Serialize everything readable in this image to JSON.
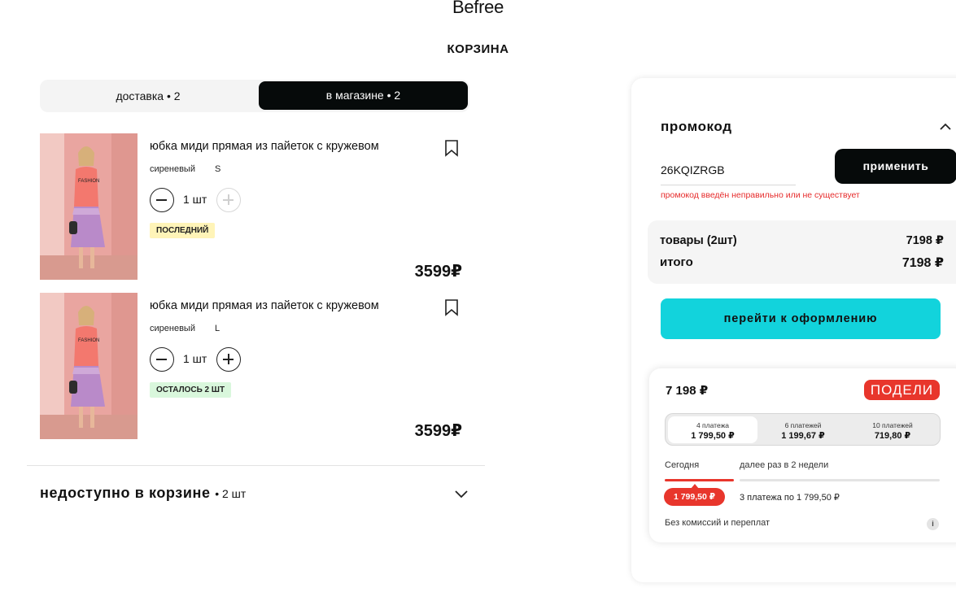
{
  "header": {
    "logo": "Befree",
    "title": "КОРЗИНА"
  },
  "tabs": [
    {
      "label": "доставка • 2",
      "active": false
    },
    {
      "label": "в магазине • 2",
      "active": true
    }
  ],
  "products": [
    {
      "name": "юбка миди прямая из пайеток с кружевом",
      "color": "сиреневый",
      "size": "S",
      "qty": "1 шт",
      "badge": "ПОСЛЕДНИЙ",
      "price": "3599₽",
      "plus_disabled": true
    },
    {
      "name": "юбка миди прямая из пайеток с кружевом",
      "color": "сиреневый",
      "size": "L",
      "qty": "1 шт",
      "badge": "ОСТАЛОСЬ 2 ШТ",
      "price": "3599₽",
      "plus_disabled": false
    }
  ],
  "unavailable": {
    "label": "недоступно в корзине",
    "count": "• 2 шт"
  },
  "promo": {
    "title": "промокод",
    "value": "26KQIZRGB",
    "apply_label": "применить",
    "error": "промокод введён неправильно или не существует"
  },
  "totals": {
    "goods_label": "товары (2шт)",
    "goods_value": "7198 ₽",
    "total_label": "итого",
    "total_value": "7198 ₽"
  },
  "checkout_label": "перейти к оформлению",
  "split": {
    "amount": "7 198 ₽",
    "brand": "ПОДЕЛИ",
    "plans": [
      {
        "title": "4 платежа",
        "value": "1 799,50 ₽"
      },
      {
        "title": "6 платежей",
        "value": "1 199,67 ₽"
      },
      {
        "title": "10 платежей",
        "value": "719,80 ₽"
      }
    ],
    "today_label": "Сегодня",
    "next_label": "далее раз в 2 недели",
    "today_amount": "1 799,50 ₽",
    "rest_label": "3 платежа по 1 799,50 ₽",
    "no_fees": "Без комиссий и переплат",
    "info_icon": "i"
  },
  "colors": {
    "accent_cyan": "#12d3dc",
    "black": "#060a0a",
    "split_red": "#e8362c",
    "error_red": "#e62b2b"
  },
  "icons": [
    "bookmark-icon",
    "minus-icon",
    "plus-icon",
    "chevron-down-icon",
    "chevron-up-icon",
    "info-icon"
  ]
}
